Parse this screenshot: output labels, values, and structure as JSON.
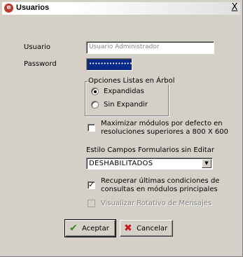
{
  "window": {
    "title": "Usuarios",
    "close_glyph": "X"
  },
  "form": {
    "usuario_label": "Usuario",
    "usuario_value": "Usuario Administrador",
    "password_label": "Password",
    "password_value": "••••••••••••••••••••"
  },
  "tree_options": {
    "legend": "Opciones Listas en Árbol",
    "expanded_label": "Expandidas",
    "collapsed_label": "Sin Expandir",
    "selected": "Expandidas"
  },
  "maximize": {
    "line1": "Maximizar módulos por defecto en",
    "line2": "resoluciones superiores a  800 X 600",
    "checked": false
  },
  "style_fields": {
    "label": "Estilo Campos Formularios sin Editar",
    "value": "DESHABILITADOS"
  },
  "recover": {
    "line1": "Recuperar últimas condiciones de",
    "line2": "consultas en módulos principales",
    "checked": true
  },
  "rotating": {
    "label": "Visualizar Rotativo de Mensajes",
    "checked": false,
    "enabled": false
  },
  "buttons": {
    "accept": "Aceptar",
    "cancel": "Cancelar"
  },
  "icons": {
    "app": "app-logo-icon",
    "accept": "check-icon",
    "cancel": "x-icon",
    "close": "close-icon",
    "dropdown": "chevron-down-icon"
  },
  "colors": {
    "password_bg": "#0a2a8a",
    "accept_icon": "#2e8b1f",
    "cancel_icon": "#cc1a1a",
    "app_icon": "#c0392b"
  }
}
